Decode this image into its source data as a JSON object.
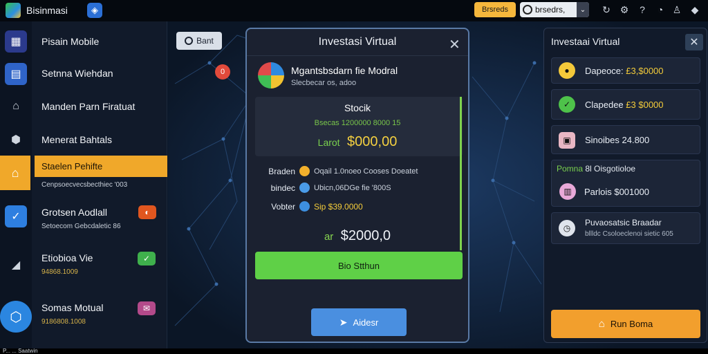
{
  "topbar": {
    "app_name": "Bisinmasi",
    "square_icon": "bookmark-icon",
    "yellow_btn": "Brsreds",
    "account_label": "brsedrs,",
    "icons": [
      "refresh-icon",
      "gear-icon",
      "help-icon",
      "bell-icon",
      "user-icon",
      "diamond-icon"
    ]
  },
  "sidebar": {
    "items": [
      {
        "title": "Pisain Mobile",
        "sub": ""
      },
      {
        "title": "Setnna Wiehdan",
        "sub": ""
      },
      {
        "title": "Manden Parn Firatuat",
        "sub": ""
      },
      {
        "title": "Menerat Bahtals",
        "sub": ""
      },
      {
        "title": "Staelen Pehifte",
        "sub": "Cenpsoecvecsbecthiec '003"
      },
      {
        "title": "Grotsen Aodlall",
        "sub": "Setoecom Gebcdaletic 86"
      },
      {
        "title": "Etiobioa Vie",
        "sub": "94868.1009"
      },
      {
        "title": "Somas Motual",
        "sub": "9186808.1008"
      }
    ],
    "bottom_text": "P... ... Saatwin"
  },
  "center": {
    "start_label": "Bant",
    "red_dot": "0"
  },
  "modal": {
    "title": "Investasi Virtual",
    "name": "Mgantsbsdarn fie Modral",
    "subtitle": "Slecbecar os, adoo",
    "stock_title": "Stocik",
    "stock_line": "Bsecas  1200000 8000 15",
    "price_label": "Larot",
    "price_value": "$000,00",
    "details": [
      {
        "key": "Braden",
        "value": "Oqail 1.0noeo Cooses Doeatet"
      },
      {
        "key": "bindec",
        "value": "Ubicn,06DGe fie '800S"
      },
      {
        "key": "Vobter",
        "value": "Sip $39.0000"
      }
    ],
    "total_label": "ar",
    "total_value": "$2000,0",
    "buy_label": "Bio Stthun",
    "action_label": "Aidesr"
  },
  "right_panel": {
    "title": "Investaai Virtual",
    "cards": [
      {
        "label": "Dapeoce:",
        "value": "£3,$0000"
      },
      {
        "label": "Clapedee",
        "value": "£3 $0000"
      },
      {
        "label": "Sinoibes",
        "value": "24.800"
      }
    ],
    "section_label": "Pomna",
    "section_rest": "8l Oisgotioloe",
    "section_item": "Parlois $001000",
    "news_title": "Puvaosatsic Braadar",
    "news_sub": "bllldc Csoloeclenoi sietic 605",
    "cta_label": "Run Boma"
  }
}
